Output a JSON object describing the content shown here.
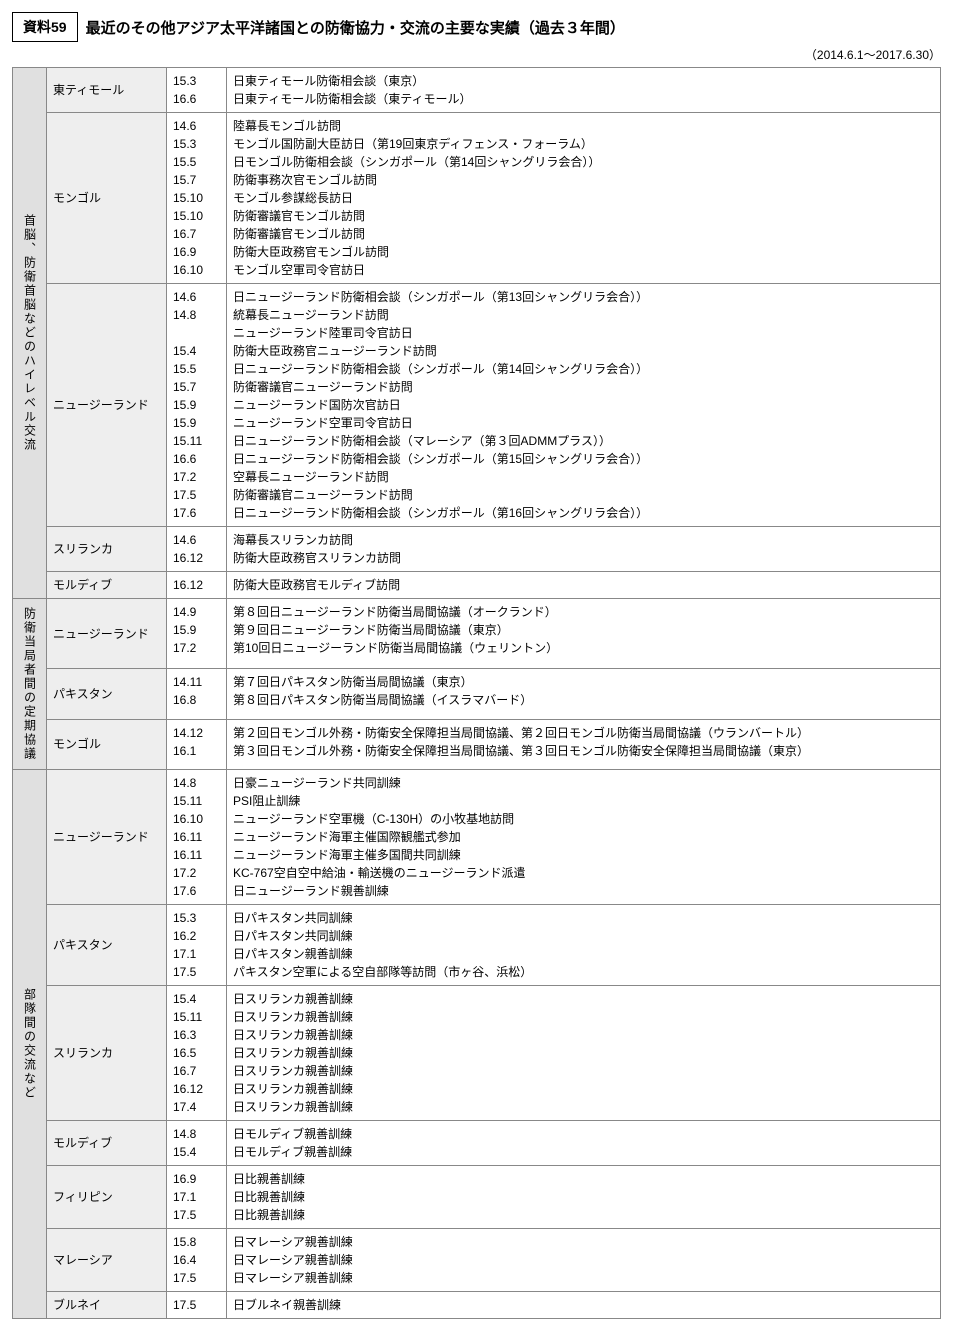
{
  "doc_tag": "資料59",
  "doc_title": "最近のその他アジア太平洋諸国との防衛協力・交流の主要な実績（過去３年間）",
  "date_range": "（2014.6.1～2017.6.30）",
  "sections": [
    {
      "category": "首脳、防衛首脳などのハイレベル交流",
      "rows": [
        {
          "country": "東ティモール",
          "dates": "15.3\n16.6",
          "desc": "日東ティモール防衛相会談（東京）\n日東ティモール防衛相会談（東ティモール）"
        },
        {
          "country": "モンゴル",
          "dates": "14.6\n15.3\n15.5\n15.7\n15.10\n15.10\n16.7\n16.9\n16.10",
          "desc": "陸幕長モンゴル訪問\nモンゴル国防副大臣訪日（第19回東京ディフェンス・フォーラム）\n日モンゴル防衛相会談（シンガポール（第14回シャングリラ会合））\n防衛事務次官モンゴル訪問\nモンゴル参謀総長訪日\n防衛審議官モンゴル訪問\n防衛審議官モンゴル訪問\n防衛大臣政務官モンゴル訪問\nモンゴル空軍司令官訪日"
        },
        {
          "country": "ニュージーランド",
          "dates": "14.6\n14.8\n\n15.4\n15.5\n15.7\n15.9\n15.9\n15.11\n16.6\n17.2\n17.5\n17.6",
          "desc": "日ニュージーランド防衛相会談（シンガポール（第13回シャングリラ会合））\n統幕長ニュージーランド訪問\nニュージーランド陸軍司令官訪日\n防衛大臣政務官ニュージーランド訪問\n日ニュージーランド防衛相会談（シンガポール（第14回シャングリラ会合））\n防衛審議官ニュージーランド訪問\nニュージーランド国防次官訪日\nニュージーランド空軍司令官訪日\n日ニュージーランド防衛相会談（マレーシア（第３回ADMMプラス））\n日ニュージーランド防衛相会談（シンガポール（第15回シャングリラ会合））\n空幕長ニュージーランド訪問\n防衛審議官ニュージーランド訪問\n日ニュージーランド防衛相会談（シンガポール（第16回シャングリラ会合））"
        },
        {
          "country": "スリランカ",
          "dates": "14.6\n16.12",
          "desc": "海幕長スリランカ訪問\n防衛大臣政務官スリランカ訪問"
        },
        {
          "country": "モルディブ",
          "dates": "16.12",
          "desc": "防衛大臣政務官モルディブ訪問"
        }
      ]
    },
    {
      "category": "防衛当局者間の定期協議",
      "rows": [
        {
          "country": "ニュージーランド",
          "dates": "14.9\n15.9\n17.2",
          "desc": "第８回日ニュージーランド防衛当局間協議（オークランド）\n第９回日ニュージーランド防衛当局間協議（東京）\n第10回日ニュージーランド防衛当局間協議（ウェリントン）"
        },
        {
          "country": "パキスタン",
          "dates": "14.11\n16.8",
          "desc": "第７回日パキスタン防衛当局間協議（東京）\n第８回日パキスタン防衛当局間協議（イスラマバード）"
        },
        {
          "country": "モンゴル",
          "dates": "14.12\n16.1",
          "desc": "第２回日モンゴル外務・防衛安全保障担当局間協議、第２回日モンゴル防衛当局間協議（ウランバートル）\n第３回日モンゴル外務・防衛安全保障担当局間協議、第３回日モンゴル防衛安全保障担当局間協議（東京）"
        }
      ]
    },
    {
      "category": "部隊間の交流など",
      "rows": [
        {
          "country": "ニュージーランド",
          "dates": "14.8\n15.11\n16.10\n16.11\n16.11\n17.2\n17.6",
          "desc": "日豪ニュージーランド共同訓練\nPSI阻止訓練\nニュージーランド空軍機（C-130H）の小牧基地訪問\nニュージーランド海軍主催国際観艦式参加\nニュージーランド海軍主催多国間共同訓練\nKC-767空自空中給油・輸送機のニュージーランド派遣\n日ニュージーランド親善訓練"
        },
        {
          "country": "パキスタン",
          "dates": "15.3\n16.2\n17.1\n17.5",
          "desc": "日パキスタン共同訓練\n日パキスタン共同訓練\n日パキスタン親善訓練\nパキスタン空軍による空自部隊等訪問（市ヶ谷、浜松）"
        },
        {
          "country": "スリランカ",
          "dates": "15.4\n15.11\n16.3\n16.5\n16.7\n16.12\n17.4",
          "desc": "日スリランカ親善訓練\n日スリランカ親善訓練\n日スリランカ親善訓練\n日スリランカ親善訓練\n日スリランカ親善訓練\n日スリランカ親善訓練\n日スリランカ親善訓練"
        },
        {
          "country": "モルディブ",
          "dates": "14.8\n15.4",
          "desc": "日モルディブ親善訓練\n日モルディブ親善訓練"
        },
        {
          "country": "フィリピン",
          "dates": "16.9\n17.1\n17.5",
          "desc": "日比親善訓練\n日比親善訓練\n日比親善訓練"
        },
        {
          "country": "マレーシア",
          "dates": "15.8\n16.4\n17.5",
          "desc": "日マレーシア親善訓練\n日マレーシア親善訓練\n日マレーシア親善訓練"
        },
        {
          "country": "ブルネイ",
          "dates": "17.5",
          "desc": "日ブルネイ親善訓練"
        }
      ]
    }
  ]
}
